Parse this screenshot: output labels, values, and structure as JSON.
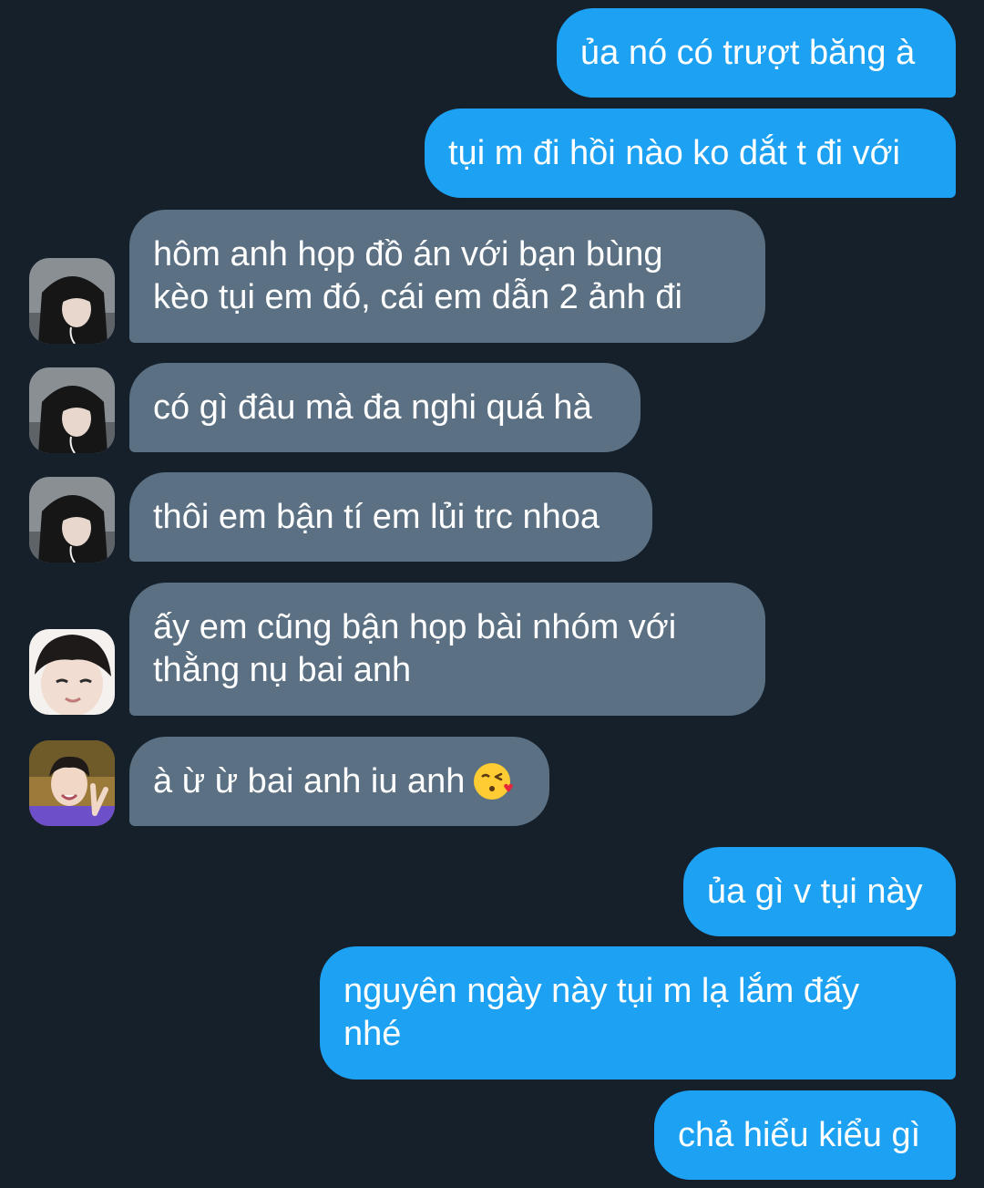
{
  "messages": [
    {
      "dir": "out",
      "text": "ủa nó có trượt băng à"
    },
    {
      "dir": "out",
      "text": "tụi m đi hồi nào ko dắt t đi với"
    },
    {
      "dir": "in",
      "text": "hôm anh họp đồ án với bạn bùng\nkèo tụi em đó, cái em dẫn 2 ảnh đi",
      "avatar": "hooded-avatar"
    },
    {
      "dir": "in",
      "text": "có gì đâu mà đa nghi quá hà",
      "avatar": "hooded-avatar"
    },
    {
      "dir": "in",
      "text": "thôi em bận tí em lủi trc nhoa",
      "avatar": "hooded-avatar"
    },
    {
      "dir": "in",
      "text": "ấy em cũng bận họp bài nhóm với\nthằng nụ bai anh",
      "avatar": "smiling-avatar"
    },
    {
      "dir": "in",
      "text": "à ừ ừ bai anh iu anh",
      "avatar": "peace-sign-avatar",
      "emoji": "face-blowing-a-kiss-icon"
    },
    {
      "dir": "out",
      "text": "ủa gì v tụi này"
    },
    {
      "dir": "out",
      "text": "nguyên ngày này tụi m lạ lắm đấy\nnhé"
    },
    {
      "dir": "out",
      "text": "chả hiểu kiểu gì"
    }
  ],
  "colors": {
    "background": "#15202b",
    "outgoing_bubble": "#1da1f2",
    "incoming_bubble": "#5b7083",
    "text": "#ffffff"
  }
}
